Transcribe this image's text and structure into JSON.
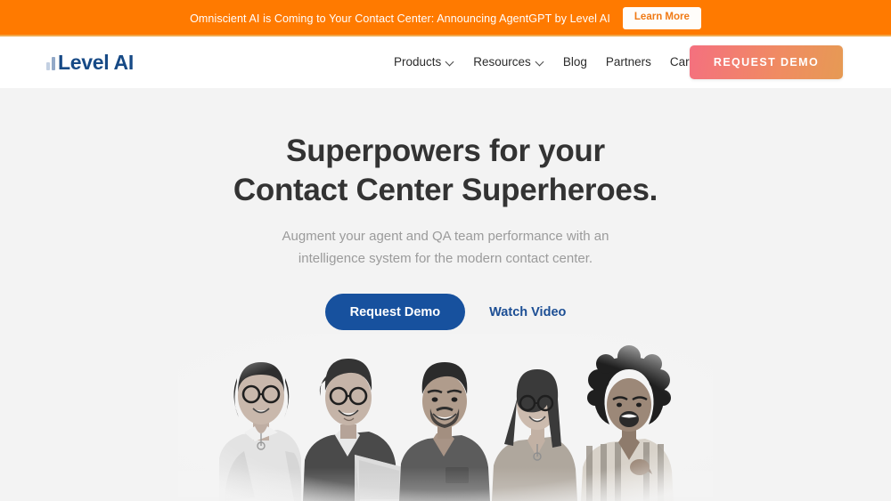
{
  "announcement": {
    "text": "Omniscient AI is Coming to Your Contact Center: Announcing AgentGPT by Level AI",
    "button_label": "Learn More",
    "background_color": "#FF7A00",
    "text_color": "#FFFFFF"
  },
  "header": {
    "brand": {
      "name": "Level AI",
      "logo_icon": "bar-chart-icon",
      "color": "#174A86"
    },
    "nav": [
      {
        "label": "Products",
        "has_dropdown": true
      },
      {
        "label": "Resources",
        "has_dropdown": true
      },
      {
        "label": "Blog",
        "has_dropdown": false
      },
      {
        "label": "Partners",
        "has_dropdown": false
      },
      {
        "label": "Careers",
        "has_dropdown": false
      }
    ],
    "cta": {
      "label": "REQUEST DEMO",
      "gradient_start": "#F4707F",
      "gradient_end": "#E69A54"
    }
  },
  "hero": {
    "title_line1": "Superpowers for your",
    "title_line2": "Contact Center Superheroes.",
    "subtitle_line1": "Augment your agent and QA team performance with an",
    "subtitle_line2": "intelligence system for the modern contact center.",
    "primary_cta": "Request Demo",
    "secondary_cta": "Watch Video",
    "background_color": "#F3F3F3",
    "title_color": "#333333",
    "subtitle_color": "#9B9B9B",
    "primary_cta_color": "#17519E",
    "image_alt": "Five smiling professionals, black and white photo"
  }
}
